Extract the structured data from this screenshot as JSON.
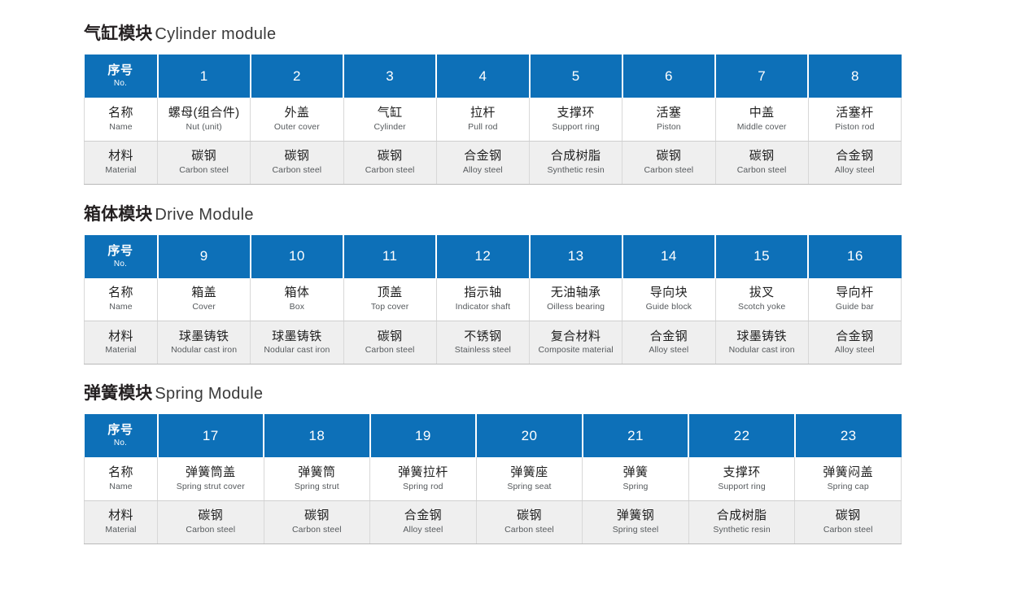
{
  "row_labels": {
    "no_zh": "序号",
    "no_en": "No.",
    "name_zh": "名称",
    "name_en": "Name",
    "material_zh": "材料",
    "material_en": "Material"
  },
  "colors": {
    "header_blue": "#0d70b8",
    "material_row_bg": "#efefef",
    "name_row_bg": "#ffffff",
    "heading_text": "#231f20",
    "cell_en_text": "#55595c"
  },
  "sections": [
    {
      "heading_zh": "气缸模块",
      "heading_en": "Cylinder module",
      "columns": [
        {
          "no": "1",
          "name_zh": "螺母(组合件)",
          "name_en": "Nut (unit)",
          "mat_zh": "碳钢",
          "mat_en": "Carbon steel"
        },
        {
          "no": "2",
          "name_zh": "外盖",
          "name_en": "Outer cover",
          "mat_zh": "碳钢",
          "mat_en": "Carbon steel"
        },
        {
          "no": "3",
          "name_zh": "气缸",
          "name_en": "Cylinder",
          "mat_zh": "碳钢",
          "mat_en": "Carbon steel"
        },
        {
          "no": "4",
          "name_zh": "拉杆",
          "name_en": "Pull rod",
          "mat_zh": "合金钢",
          "mat_en": "Alloy steel"
        },
        {
          "no": "5",
          "name_zh": "支撑环",
          "name_en": "Support ring",
          "mat_zh": "合成树脂",
          "mat_en": "Synthetic resin"
        },
        {
          "no": "6",
          "name_zh": "活塞",
          "name_en": "Piston",
          "mat_zh": "碳钢",
          "mat_en": "Carbon steel"
        },
        {
          "no": "7",
          "name_zh": "中盖",
          "name_en": "Middle cover",
          "mat_zh": "碳钢",
          "mat_en": "Carbon steel"
        },
        {
          "no": "8",
          "name_zh": "活塞杆",
          "name_en": "Piston rod",
          "mat_zh": "合金钢",
          "mat_en": "Alloy steel"
        }
      ]
    },
    {
      "heading_zh": "箱体模块",
      "heading_en": "Drive Module",
      "columns": [
        {
          "no": "9",
          "name_zh": "箱盖",
          "name_en": "Cover",
          "mat_zh": "球墨铸铁",
          "mat_en": "Nodular cast iron"
        },
        {
          "no": "10",
          "name_zh": "箱体",
          "name_en": "Box",
          "mat_zh": "球墨铸铁",
          "mat_en": "Nodular cast iron"
        },
        {
          "no": "11",
          "name_zh": "顶盖",
          "name_en": "Top cover",
          "mat_zh": "碳钢",
          "mat_en": "Carbon steel"
        },
        {
          "no": "12",
          "name_zh": "指示轴",
          "name_en": "Indicator shaft",
          "mat_zh": "不锈钢",
          "mat_en": "Stainless steel"
        },
        {
          "no": "13",
          "name_zh": "无油轴承",
          "name_en": "Oilless bearing",
          "mat_zh": "复合材料",
          "mat_en": "Composite material"
        },
        {
          "no": "14",
          "name_zh": "导向块",
          "name_en": "Guide block",
          "mat_zh": "合金钢",
          "mat_en": "Alloy steel"
        },
        {
          "no": "15",
          "name_zh": "拔叉",
          "name_en": "Scotch yoke",
          "mat_zh": "球墨铸铁",
          "mat_en": "Nodular cast iron"
        },
        {
          "no": "16",
          "name_zh": "导向杆",
          "name_en": "Guide bar",
          "mat_zh": "合金钢",
          "mat_en": "Alloy steel"
        }
      ]
    },
    {
      "heading_zh": "弹簧模块",
      "heading_en": "Spring Module",
      "columns": [
        {
          "no": "17",
          "name_zh": "弹簧筒盖",
          "name_en": "Spring strut cover",
          "mat_zh": "碳钢",
          "mat_en": "Carbon steel"
        },
        {
          "no": "18",
          "name_zh": "弹簧筒",
          "name_en": "Spring strut",
          "mat_zh": "碳钢",
          "mat_en": "Carbon steel"
        },
        {
          "no": "19",
          "name_zh": "弹簧拉杆",
          "name_en": "Spring rod",
          "mat_zh": "合金钢",
          "mat_en": "Alloy steel"
        },
        {
          "no": "20",
          "name_zh": "弹簧座",
          "name_en": "Spring seat",
          "mat_zh": "碳钢",
          "mat_en": "Carbon steel"
        },
        {
          "no": "21",
          "name_zh": "弹簧",
          "name_en": "Spring",
          "mat_zh": "弹簧钢",
          "mat_en": "Spring steel"
        },
        {
          "no": "22",
          "name_zh": "支撑环",
          "name_en": "Support ring",
          "mat_zh": "合成树脂",
          "mat_en": "Synthetic resin"
        },
        {
          "no": "23",
          "name_zh": "弹簧闷盖",
          "name_en": "Spring cap",
          "mat_zh": "碳钢",
          "mat_en": "Carbon steel"
        }
      ]
    }
  ]
}
